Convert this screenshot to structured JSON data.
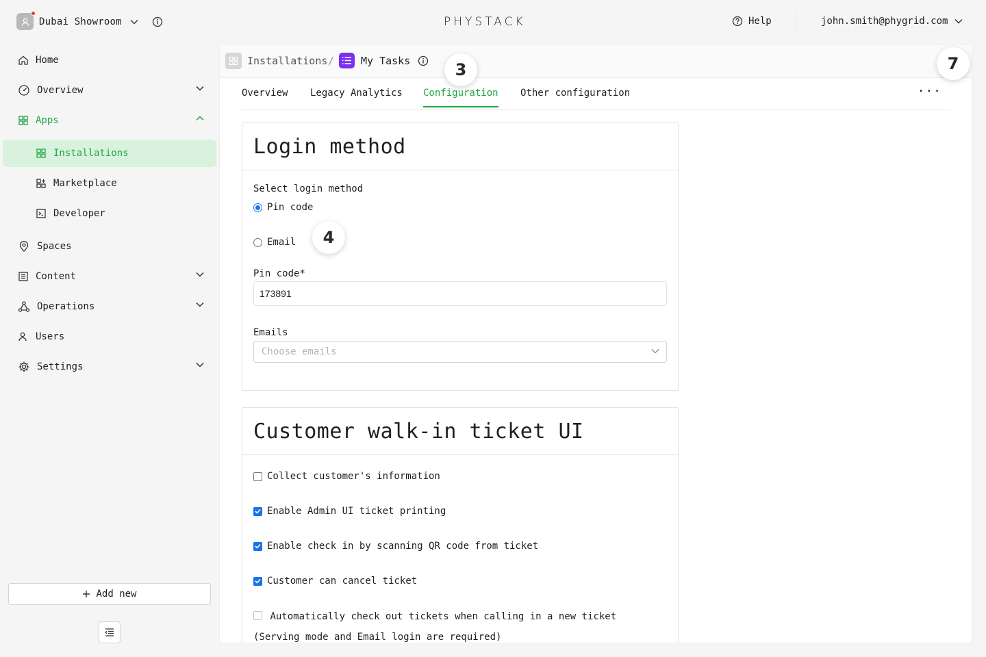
{
  "topbar": {
    "org_name": "Dubai Showroom",
    "logo": "PHYSTACK",
    "help_label": "Help",
    "user_email": "john.smith@phygrid.com"
  },
  "sidebar": {
    "items": [
      {
        "label": "Home",
        "icon": "home-icon"
      },
      {
        "label": "Overview",
        "icon": "gauge-icon"
      },
      {
        "label": "Apps",
        "icon": "grid-icon"
      },
      {
        "label": "Installations",
        "icon": "grid-icon"
      },
      {
        "label": "Marketplace",
        "icon": "apps-plus-icon"
      },
      {
        "label": "Developer",
        "icon": "terminal-icon"
      },
      {
        "label": "Spaces",
        "icon": "location-pin-icon"
      },
      {
        "label": "Content",
        "icon": "list-icon"
      },
      {
        "label": "Operations",
        "icon": "nodes-icon"
      },
      {
        "label": "Users",
        "icon": "users-icon"
      },
      {
        "label": "Settings",
        "icon": "gear-icon"
      }
    ],
    "add_new_label": "Add new"
  },
  "breadcrumb": {
    "parent": "Installations",
    "separator": "/",
    "current": "My Tasks"
  },
  "tabs": [
    "Overview",
    "Legacy Analytics",
    "Configuration",
    "Other configuration"
  ],
  "tab_more": "···",
  "login_card": {
    "title": "Login method",
    "select_label": "Select login method",
    "options": [
      "Pin code",
      "Email"
    ],
    "selected_option": "Pin code",
    "pin_label": "Pin code*",
    "pin_value": "173891",
    "emails_label": "Emails",
    "emails_placeholder": "Choose emails"
  },
  "ticket_card": {
    "title": "Customer walk-in ticket UI",
    "checkboxes": [
      {
        "label": "Collect customer's information",
        "checked": false
      },
      {
        "label": "Enable Admin UI ticket printing",
        "checked": true
      },
      {
        "label": "Enable check in by scanning QR code from ticket",
        "checked": true
      },
      {
        "label": "Customer can cancel ticket",
        "checked": true
      },
      {
        "label": "Automatically check out tickets when calling in a new ticket (Serving mode and Email login are required)",
        "checked": false
      }
    ]
  },
  "badges": [
    "3",
    "4",
    "7"
  ],
  "colors": {
    "accent": "#1ea446",
    "active_bg": "#d9f2dd",
    "checkbox_blue": "#1a73e8",
    "app_icon": "#7b2ff0"
  }
}
